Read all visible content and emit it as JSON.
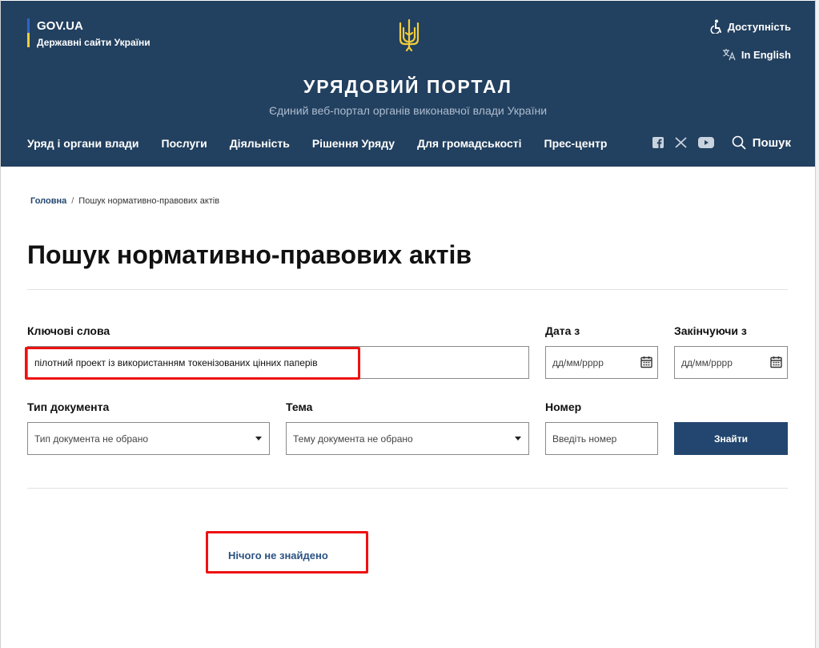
{
  "header": {
    "gov_title": "GOV.UA",
    "gov_subtitle": "Державні сайти України",
    "accessibility": "Доступність",
    "language": "In English",
    "portal_title": "УРЯДОВИЙ ПОРТАЛ",
    "portal_subtitle": "Єдиний веб-портал органів виконавчої влади України",
    "nav": [
      "Уряд і органи влади",
      "Послуги",
      "Діяльність",
      "Рішення Уряду",
      "Для громадськості",
      "Прес-центр"
    ],
    "search_label": "Пошук",
    "colors": {
      "background": "#22405f",
      "flag_blue": "#2d65c9",
      "flag_yellow": "#f2cd3a"
    }
  },
  "breadcrumb": {
    "home": "Головна",
    "separator": "/",
    "current": "Пошук нормативно-правових актів"
  },
  "page_title": "Пошук нормативно-правових актів",
  "form": {
    "keywords_label": "Ключові слова",
    "keywords_value": "пілотний проект із використанням токенізованих цінних паперів",
    "date_from_label": "Дата з",
    "date_from_placeholder": "дд/мм/рррр",
    "date_to_label": "Закінчуючи з",
    "date_to_placeholder": "дд/мм/рррр",
    "doc_type_label": "Тип документа",
    "doc_type_value": "Тип документа не обрано",
    "topic_label": "Тема",
    "topic_value": "Тему документа не обрано",
    "number_label": "Номер",
    "number_placeholder": "Введіть номер",
    "submit_label": "Знайти"
  },
  "results": {
    "message": "Нічого не знайдено"
  },
  "accent_colors": {
    "highlight": "#ee1111",
    "primary_button": "#22466f"
  }
}
